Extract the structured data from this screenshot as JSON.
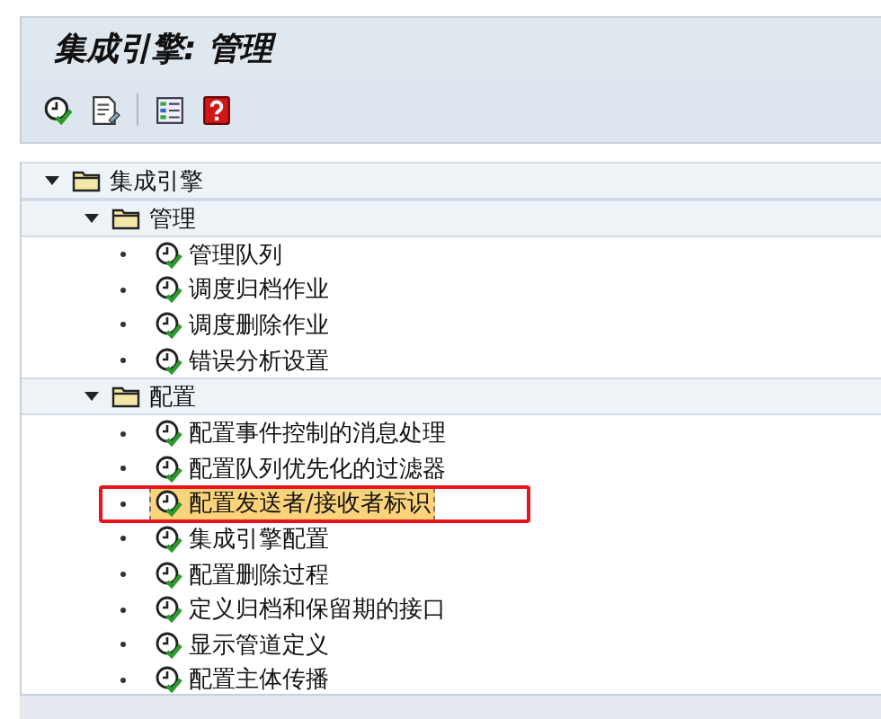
{
  "window": {
    "title": "集成引擎: 管理"
  },
  "toolbar": [
    {
      "kind": "execute"
    },
    {
      "kind": "document"
    },
    {
      "kind": "separator"
    },
    {
      "kind": "list"
    },
    {
      "kind": "help"
    }
  ],
  "tree": [
    {
      "label": "集成引擎",
      "expanded": true,
      "children": [
        {
          "label": "管理",
          "expanded": true,
          "children": [
            {
              "label": "管理队列",
              "selected": false
            },
            {
              "label": "调度归档作业",
              "selected": false
            },
            {
              "label": "调度删除作业",
              "selected": false
            },
            {
              "label": "错误分析设置",
              "selected": false
            }
          ]
        },
        {
          "label": "配置",
          "expanded": true,
          "children": [
            {
              "label": "配置事件控制的消息处理",
              "selected": false
            },
            {
              "label": "配置队列优先化的过滤器",
              "selected": false
            },
            {
              "label": "配置发送者/接收者标识",
              "selected": true
            },
            {
              "label": "集成引擎配置",
              "selected": false
            },
            {
              "label": "配置删除过程",
              "selected": false
            },
            {
              "label": "定义归档和保留期的接口",
              "selected": false
            },
            {
              "label": "显示管道定义",
              "selected": false
            },
            {
              "label": "配置主体传播",
              "selected": false
            }
          ]
        }
      ]
    }
  ],
  "annotation": {
    "kind": "red-frame"
  }
}
